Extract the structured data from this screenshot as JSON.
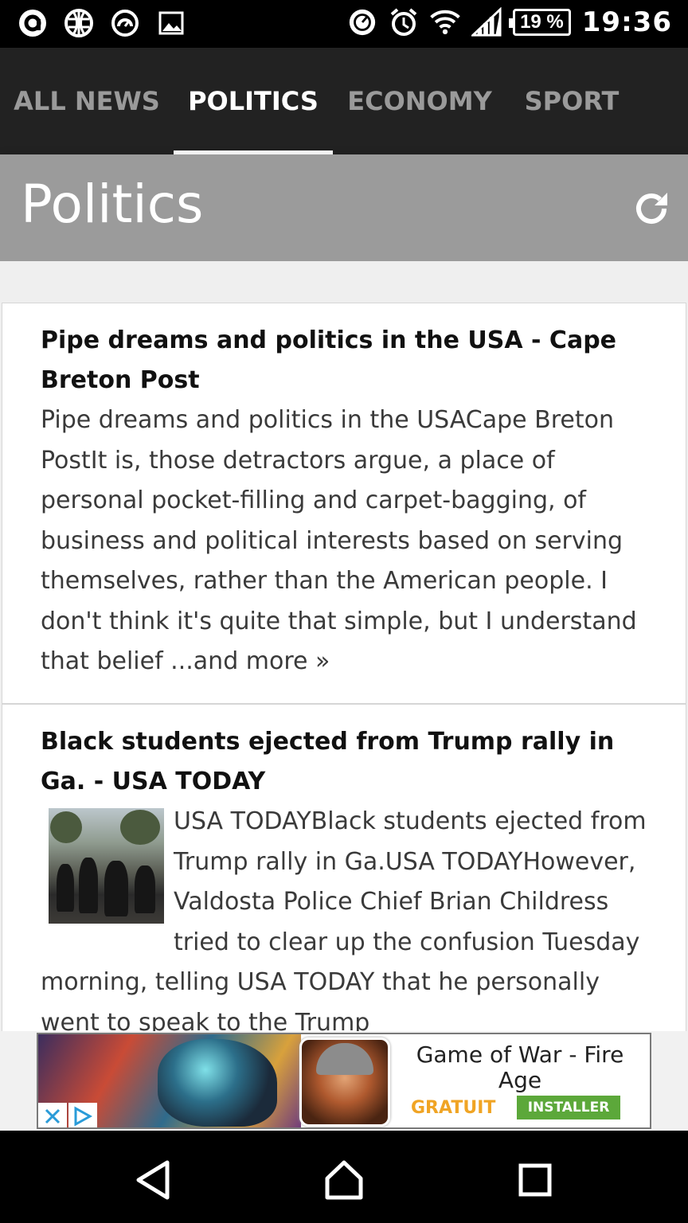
{
  "status_bar": {
    "left_icons": [
      "app-a-icon",
      "globe-icon",
      "speedometer-icon",
      "image-icon"
    ],
    "right_icons": [
      "data-saver-icon",
      "alarm-icon",
      "wifi-icon",
      "signal-icon"
    ],
    "battery": "19 %",
    "time": "19:36"
  },
  "tabs": [
    {
      "label": "ALL NEWS",
      "active": false
    },
    {
      "label": "POLITICS",
      "active": true
    },
    {
      "label": "ECONOMY",
      "active": false
    },
    {
      "label": "SPORT",
      "active": false
    }
  ],
  "header": {
    "title": "Politics",
    "refresh_icon": "refresh-icon"
  },
  "articles": [
    {
      "title": "Pipe dreams and politics in the USA - Cape Breton Post",
      "body": "Pipe dreams and politics in the USACape Breton PostIt is, those detractors argue, a place of personal pocket-filling and carpet-bagging, of business and political interests based on serving themselves, rather than the American people. I don't think it's quite that simple, but I understand that belief ...and more »"
    },
    {
      "title": "Black students ejected from Trump rally in Ga. - USA TODAY",
      "body": "USA TODAYBlack students ejected from Trump rally in Ga.USA TODAYHowever, Valdosta Police Chief Brian Childress tried to clear up the confusion Tuesday morning, telling USA TODAY that he personally went to speak to the Trump"
    }
  ],
  "ad": {
    "title": "Game of War - Fire Age",
    "price": "GRATUIT",
    "install": "INSTALLER"
  },
  "nav": [
    "back-icon",
    "home-icon",
    "recents-icon"
  ]
}
